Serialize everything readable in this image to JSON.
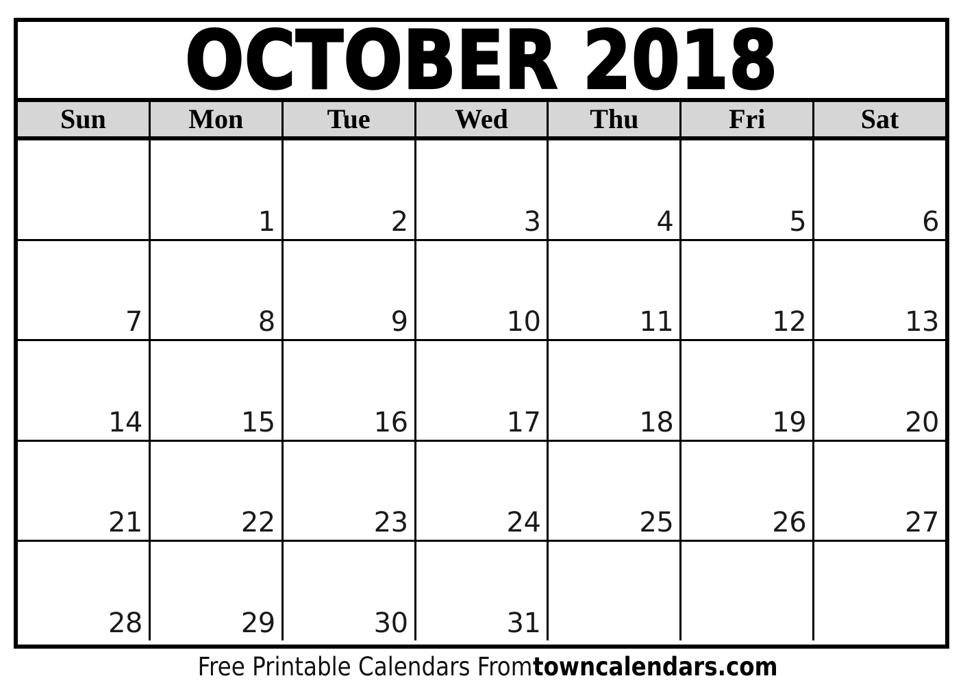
{
  "title": "OCTOBER 2018",
  "month": "OCTOBER",
  "year": "2018",
  "colors": {
    "header_background": "#d6d6d6",
    "border": "#000000",
    "cell_background": "#ffffff",
    "text": "#000000"
  },
  "weekdays": [
    {
      "label": "Sun"
    },
    {
      "label": "Mon"
    },
    {
      "label": "Tue"
    },
    {
      "label": "Wed"
    },
    {
      "label": "Thu"
    },
    {
      "label": "Fri"
    },
    {
      "label": "Sat"
    }
  ],
  "weeks": [
    [
      {
        "day": ""
      },
      {
        "day": "1"
      },
      {
        "day": "2"
      },
      {
        "day": "3"
      },
      {
        "day": "4"
      },
      {
        "day": "5"
      },
      {
        "day": "6"
      }
    ],
    [
      {
        "day": "7"
      },
      {
        "day": "8"
      },
      {
        "day": "9"
      },
      {
        "day": "10"
      },
      {
        "day": "11"
      },
      {
        "day": "12"
      },
      {
        "day": "13"
      }
    ],
    [
      {
        "day": "14"
      },
      {
        "day": "15"
      },
      {
        "day": "16"
      },
      {
        "day": "17"
      },
      {
        "day": "18"
      },
      {
        "day": "19"
      },
      {
        "day": "20"
      }
    ],
    [
      {
        "day": "21"
      },
      {
        "day": "22"
      },
      {
        "day": "23"
      },
      {
        "day": "24"
      },
      {
        "day": "25"
      },
      {
        "day": "26"
      },
      {
        "day": "27"
      }
    ],
    [
      {
        "day": "28"
      },
      {
        "day": "29"
      },
      {
        "day": "30"
      },
      {
        "day": "31"
      },
      {
        "day": ""
      },
      {
        "day": ""
      },
      {
        "day": ""
      }
    ]
  ],
  "footer": {
    "text": "Free Printable Calendars From ",
    "brand": "towncalendars.com"
  }
}
